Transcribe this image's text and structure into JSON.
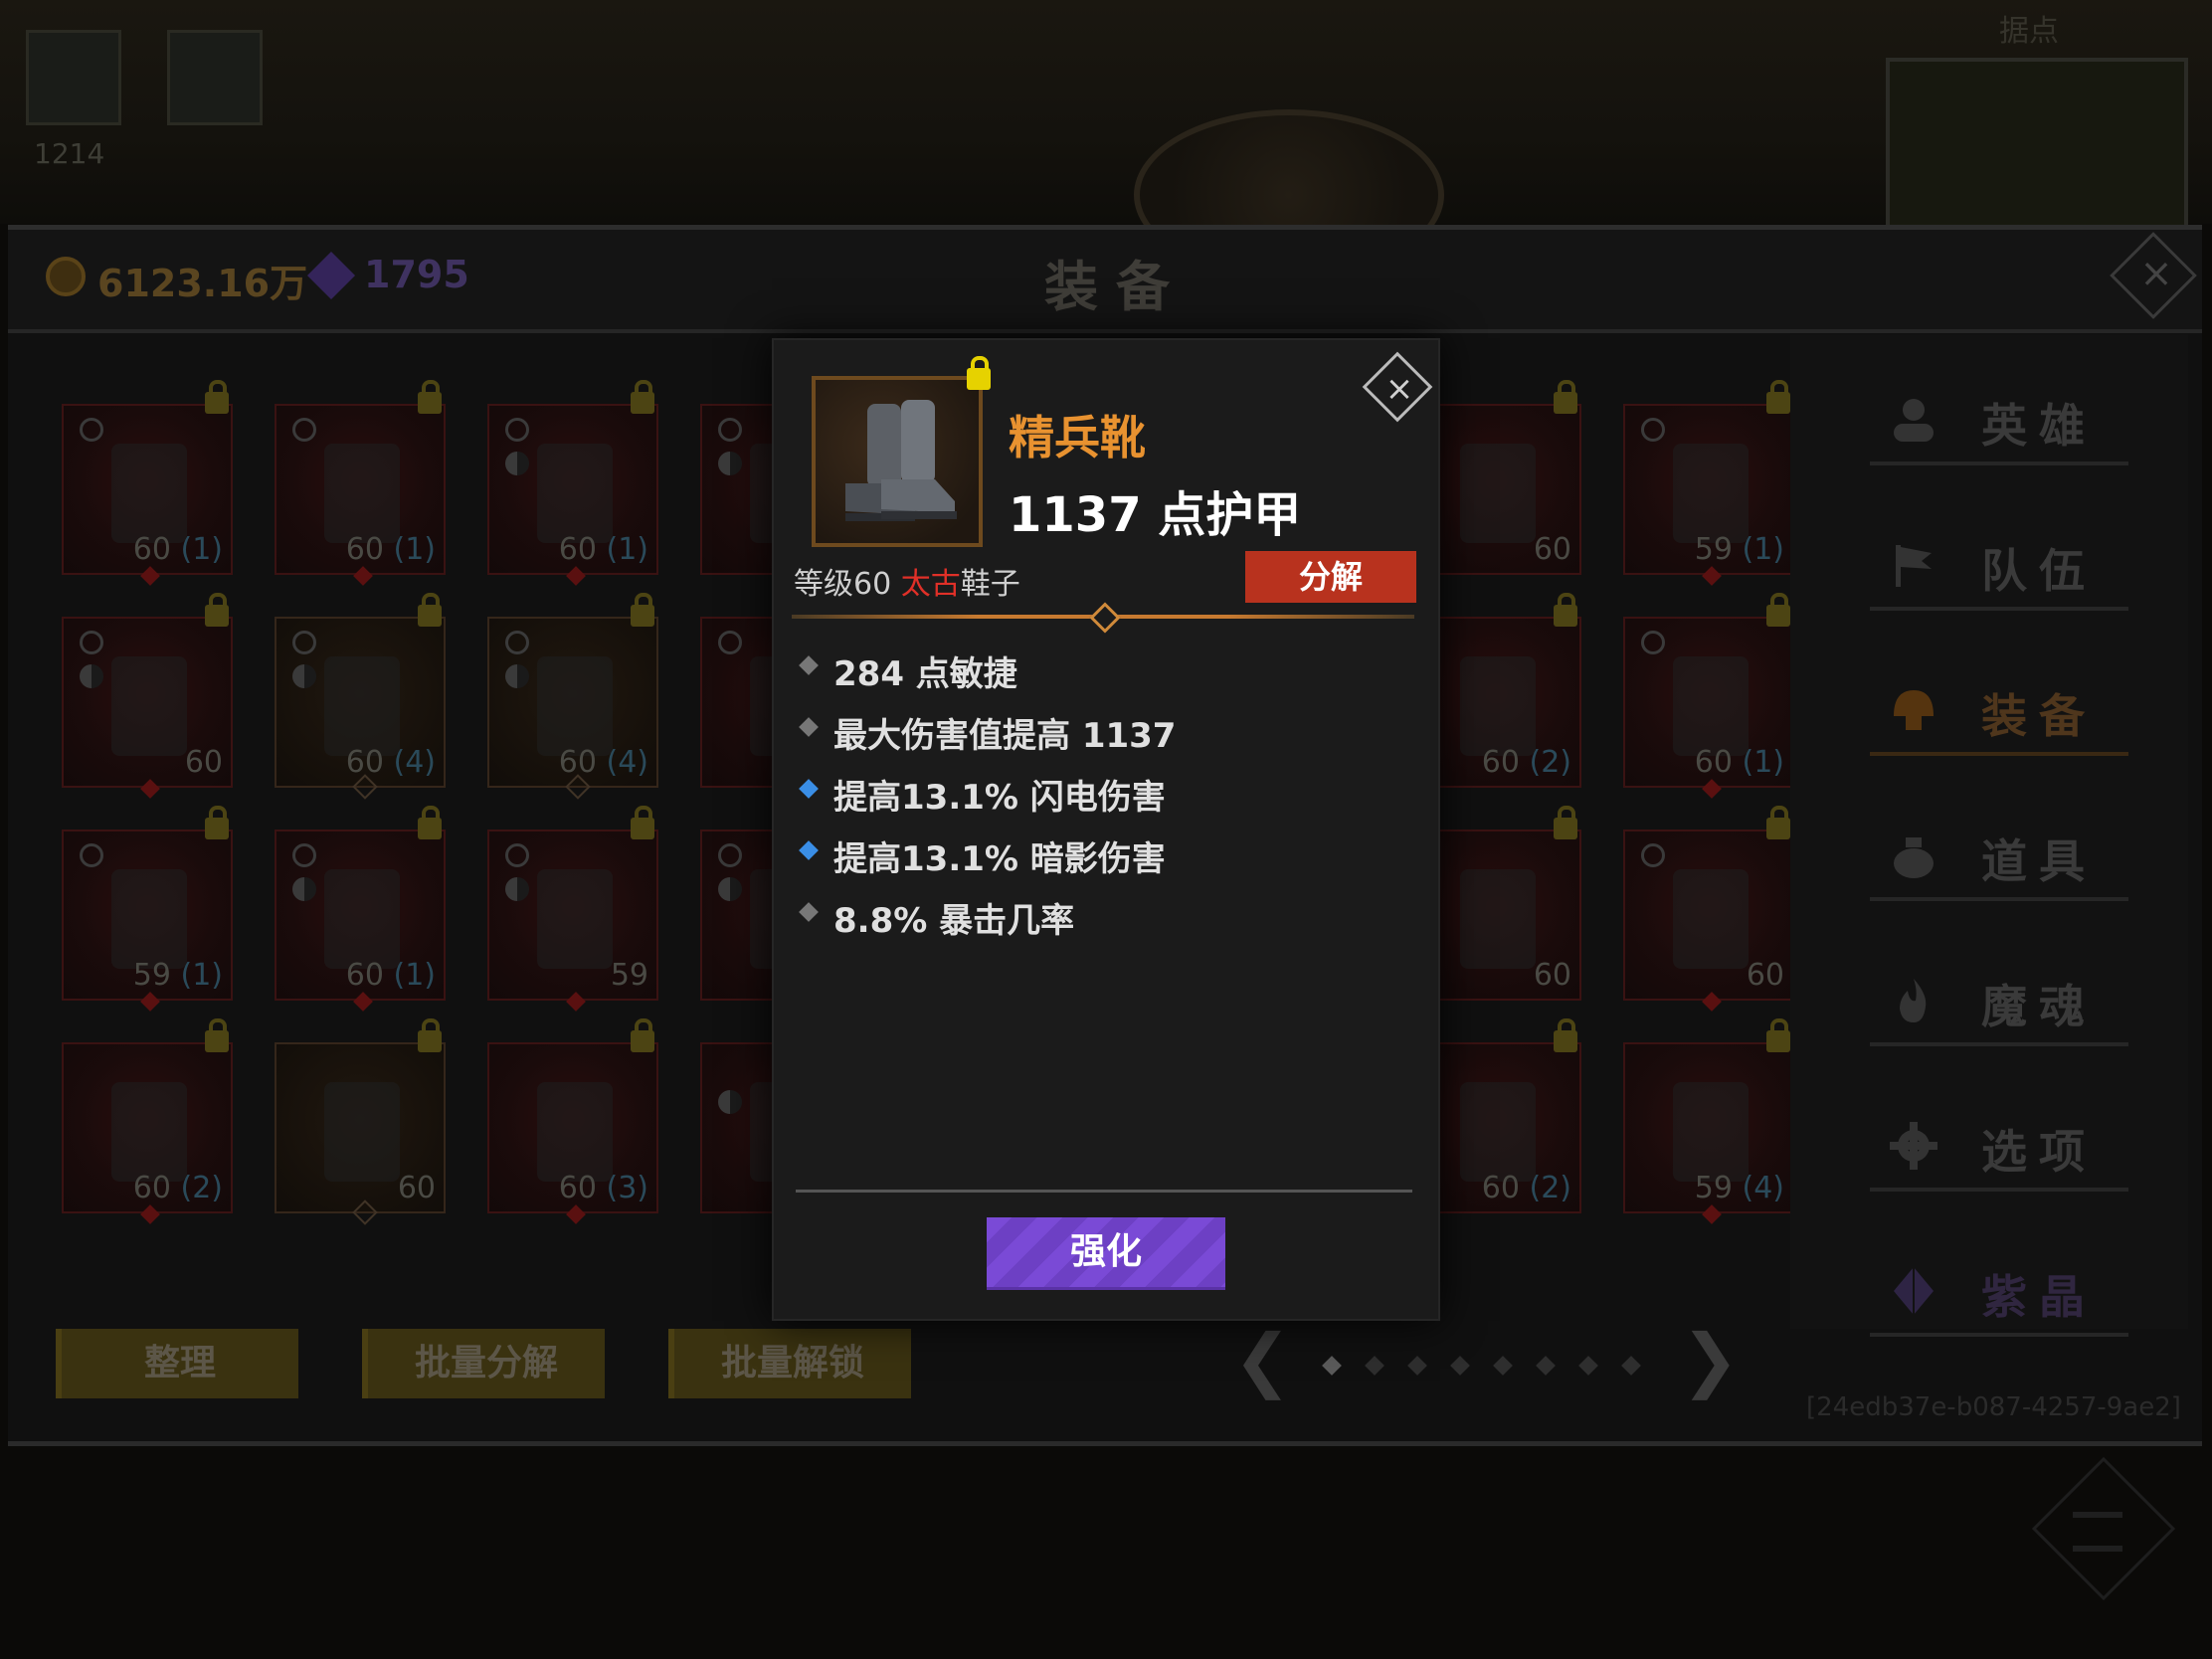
{
  "topbar": {
    "slot1_number": "1214",
    "slot2_number": "",
    "minimap_label": "据点"
  },
  "panel": {
    "title": "装备",
    "gold": "6123.16万",
    "gems": "1795",
    "close_icon": "close-icon"
  },
  "grid": {
    "rows": [
      [
        {
          "level": "60",
          "count": "(1)"
        },
        {
          "level": "60",
          "count": "(1)"
        },
        {
          "level": "60",
          "count": "(1)"
        },
        {
          "level": "",
          "count": ""
        },
        {
          "level": "60",
          "count": ""
        },
        {
          "level": "59",
          "count": "(1)"
        }
      ],
      [
        {
          "level": "60",
          "count": ""
        },
        {
          "level": "60",
          "count": "(4)"
        },
        {
          "level": "60",
          "count": "(4)"
        },
        {
          "level": "",
          "count": ""
        },
        {
          "level": "60",
          "count": "(2)"
        },
        {
          "level": "60",
          "count": "(1)"
        }
      ],
      [
        {
          "level": "59",
          "count": "(1)"
        },
        {
          "level": "60",
          "count": "(1)"
        },
        {
          "level": "59",
          "count": ""
        },
        {
          "level": "",
          "count": ""
        },
        {
          "level": "60",
          "count": ""
        },
        {
          "level": "60",
          "count": ""
        }
      ],
      [
        {
          "level": "60",
          "count": "(2)"
        },
        {
          "level": "60",
          "count": ""
        },
        {
          "level": "60",
          "count": "(3)"
        },
        {
          "level": "",
          "count": ""
        },
        {
          "level": "60",
          "count": "(2)"
        },
        {
          "level": "59",
          "count": "(4)"
        }
      ]
    ]
  },
  "bottom_buttons": {
    "sort": "整理",
    "batch_decompose": "批量分解",
    "batch_unlock": "批量解锁"
  },
  "pager": {
    "prev": "❮",
    "next": "❯",
    "current_page": 1,
    "total_pages": 8
  },
  "uuid": "[24edb37e-b087-4257-9ae2]",
  "tabs": [
    {
      "label": "英雄",
      "icon": "hero-icon"
    },
    {
      "label": "队伍",
      "icon": "flag-icon"
    },
    {
      "label": "装备",
      "icon": "helmet-icon",
      "active": true
    },
    {
      "label": "道具",
      "icon": "bag-icon"
    },
    {
      "label": "魔魂",
      "icon": "flame-icon"
    },
    {
      "label": "选项",
      "icon": "gear-icon"
    },
    {
      "label": "紫晶",
      "icon": "crystal-icon"
    }
  ],
  "item": {
    "name": "精兵靴",
    "main_stat": "1137 点护甲",
    "level_prefix": "等级60 ",
    "tier": "太古",
    "type": "鞋子",
    "decompose": "分解",
    "stats": [
      {
        "text": "284 点敏捷",
        "type": "normal"
      },
      {
        "text": "最大伤害值提高 1137",
        "type": "normal"
      },
      {
        "text": "提高13.1% 闪电伤害",
        "type": "magic"
      },
      {
        "text": "提高13.1% 暗影伤害",
        "type": "magic"
      },
      {
        "text": "8.8% 暴击几率",
        "type": "normal"
      }
    ],
    "strengthen": "强化",
    "close": "×"
  },
  "colors": {
    "item_name": "#e89230",
    "tier": "#e03028",
    "decompose_button": "#b8321e",
    "strengthen_button": "#7a4ad6",
    "magic_stat_marker": "#3a8ee6"
  }
}
